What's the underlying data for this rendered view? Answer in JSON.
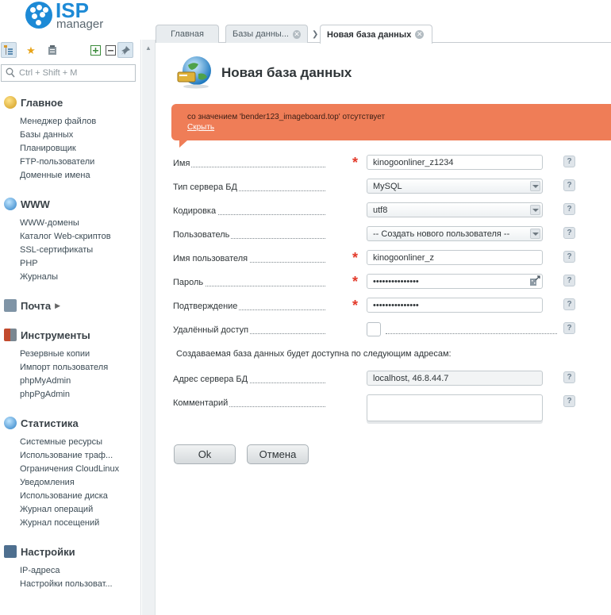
{
  "logo": {
    "text_isp": "ISP",
    "text_manager": "manager"
  },
  "sidebar": {
    "search_placeholder": "Ctrl + Shift + M",
    "groups": [
      {
        "title": "Главное",
        "items": [
          "Менеджер файлов",
          "Базы данных",
          "Планировщик",
          "FTP-пользователи",
          "Доменные имена"
        ]
      },
      {
        "title": "WWW",
        "items": [
          "WWW-домены",
          "Каталог Web-скриптов",
          "SSL-сертификаты",
          "PHP",
          "Журналы"
        ]
      },
      {
        "title": "Почта",
        "items": []
      },
      {
        "title": "Инструменты",
        "items": [
          "Резервные копии",
          "Импорт пользователя",
          "phpMyAdmin",
          "phpPgAdmin"
        ]
      },
      {
        "title": "Статистика",
        "items": [
          "Системные ресурсы",
          "Использование траф...",
          "Ограничения CloudLinux",
          "Уведомления",
          "Использование диска",
          "Журнал операций",
          "Журнал посещений"
        ]
      },
      {
        "title": "Настройки",
        "items": [
          "IP-адреса",
          "Настройки пользоват..."
        ]
      }
    ]
  },
  "tabs": [
    {
      "label": "Главная"
    },
    {
      "label": "Базы данны..."
    },
    {
      "label": "Новая база данных"
    }
  ],
  "page": {
    "title": "Новая база данных",
    "alert_text": "со значением 'bender123_imageboard.top' отсутствует",
    "alert_link": "Скрыть"
  },
  "form": {
    "name_label": "Имя",
    "name_value": "kinogoonliner_z1234",
    "server_type_label": "Тип сервера БД",
    "server_type_value": "MySQL",
    "encoding_label": "Кодировка",
    "encoding_value": "utf8",
    "user_label": "Пользователь",
    "user_value": "-- Создать нового пользователя --",
    "username_label": "Имя пользователя",
    "username_value": "kinogoonliner_z",
    "password_label": "Пароль",
    "password_value": "•••••••••••••••",
    "confirm_label": "Подтверждение",
    "confirm_value": "•••••••••••••••",
    "remote_label": "Удалённый доступ",
    "note_text": "Создаваемая база данных будет доступна по следующим адресам:",
    "address_label": "Адрес сервера БД",
    "address_value": "localhost, 46.8.44.7",
    "comment_label": "Комментарий",
    "help_glyph": "?",
    "required_glyph": "*"
  },
  "buttons": {
    "ok": "Ok",
    "cancel": "Отмена"
  }
}
